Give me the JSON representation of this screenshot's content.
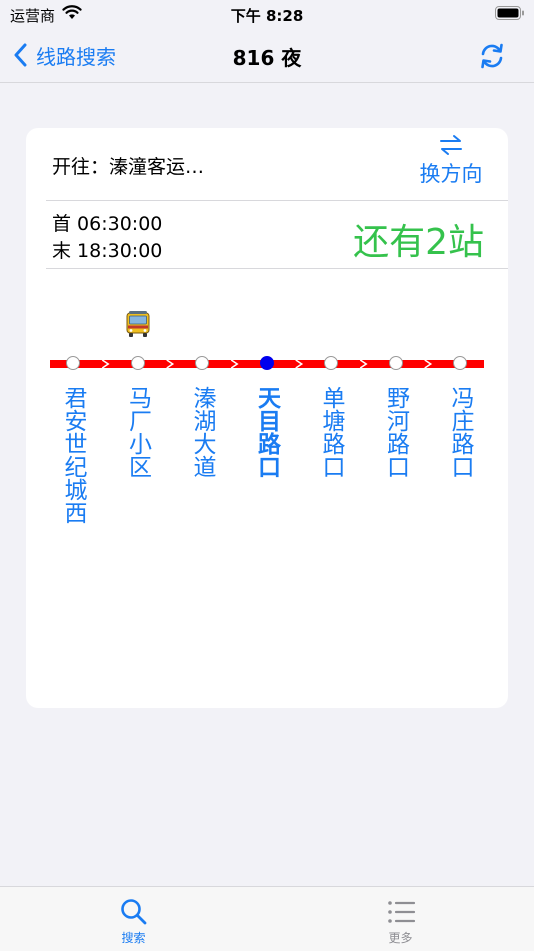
{
  "status_bar": {
    "carrier": "运营商",
    "time": "下午 8:28"
  },
  "nav": {
    "back_label": "线路搜索",
    "title": "816 夜"
  },
  "card": {
    "direction": "开往：溱潼客运…",
    "swap_label": "换方向",
    "first_bus": "首  06:30:00",
    "last_bus": "末  18:30:00",
    "remaining": "还有2站"
  },
  "route": {
    "line_color": "#ff0000",
    "current_stop_index": 3,
    "bus_position_index": 1,
    "stops": [
      {
        "name": "君安世纪城西"
      },
      {
        "name": "马厂小区"
      },
      {
        "name": "溱湖大道"
      },
      {
        "name": "天目路口"
      },
      {
        "name": "单塘路口"
      },
      {
        "name": "野河路口"
      },
      {
        "name": "冯庄路口"
      }
    ]
  },
  "tabs": [
    {
      "label": "搜索",
      "icon": "search-icon",
      "active": true
    },
    {
      "label": "更多",
      "icon": "list-icon",
      "active": false
    }
  ],
  "colors": {
    "accent": "#1a7cf2",
    "remaining": "#35c24c",
    "current_stop": "#0000ee"
  }
}
